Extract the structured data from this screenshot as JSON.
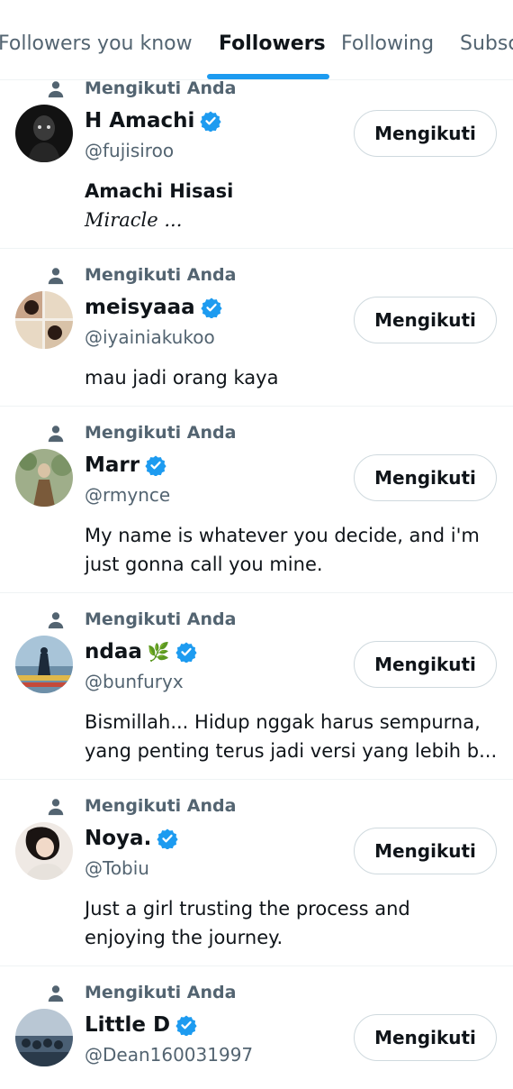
{
  "tabs": [
    {
      "label": "Followers you know"
    },
    {
      "label": "Followers"
    },
    {
      "label": "Following"
    },
    {
      "label": "Subscriptions"
    }
  ],
  "active_tab": "Followers",
  "colors": {
    "accent": "#1d9bf0",
    "secondary_text": "#536471",
    "border": "#cfd9de"
  },
  "users": [
    {
      "context": "Mengikuti Anda",
      "name": "H Amachi",
      "handle": "@fujisiroo",
      "verified": true,
      "button": "Mengikuti",
      "bio_title": "Amachi Hisasi",
      "bio": "Miracle ..."
    },
    {
      "context": "Mengikuti Anda",
      "name": "meisyaaa",
      "handle": "@iyainiakukoo",
      "verified": true,
      "button": "Mengikuti",
      "bio": "mau jadi orang kaya"
    },
    {
      "context": "Mengikuti Anda",
      "name": "Marr",
      "handle": "@rmynce",
      "verified": true,
      "button": "Mengikuti",
      "bio_line1": "My name is whatever you decide, and i'm",
      "bio_line2": "just gonna call you mine."
    },
    {
      "context": "Mengikuti Anda",
      "name": "ndaa",
      "emoji": "🌿",
      "handle": "@bunfuryx",
      "verified": true,
      "button": "Mengikuti",
      "bio_line1": "Bismillah... Hidup nggak harus sempurna,",
      "bio_line2": "yang penting terus jadi versi yang lebih b..."
    },
    {
      "context": "Mengikuti Anda",
      "name": "Noya.",
      "handle": "@Tobiu",
      "verified": true,
      "button": "Mengikuti",
      "bio_line1": "Just a girl trusting the process and",
      "bio_line2": "enjoying the journey."
    },
    {
      "context": "Mengikuti Anda",
      "name": "Little D",
      "handle": "@Dean160031997",
      "verified": true,
      "button": "Mengikuti"
    }
  ]
}
